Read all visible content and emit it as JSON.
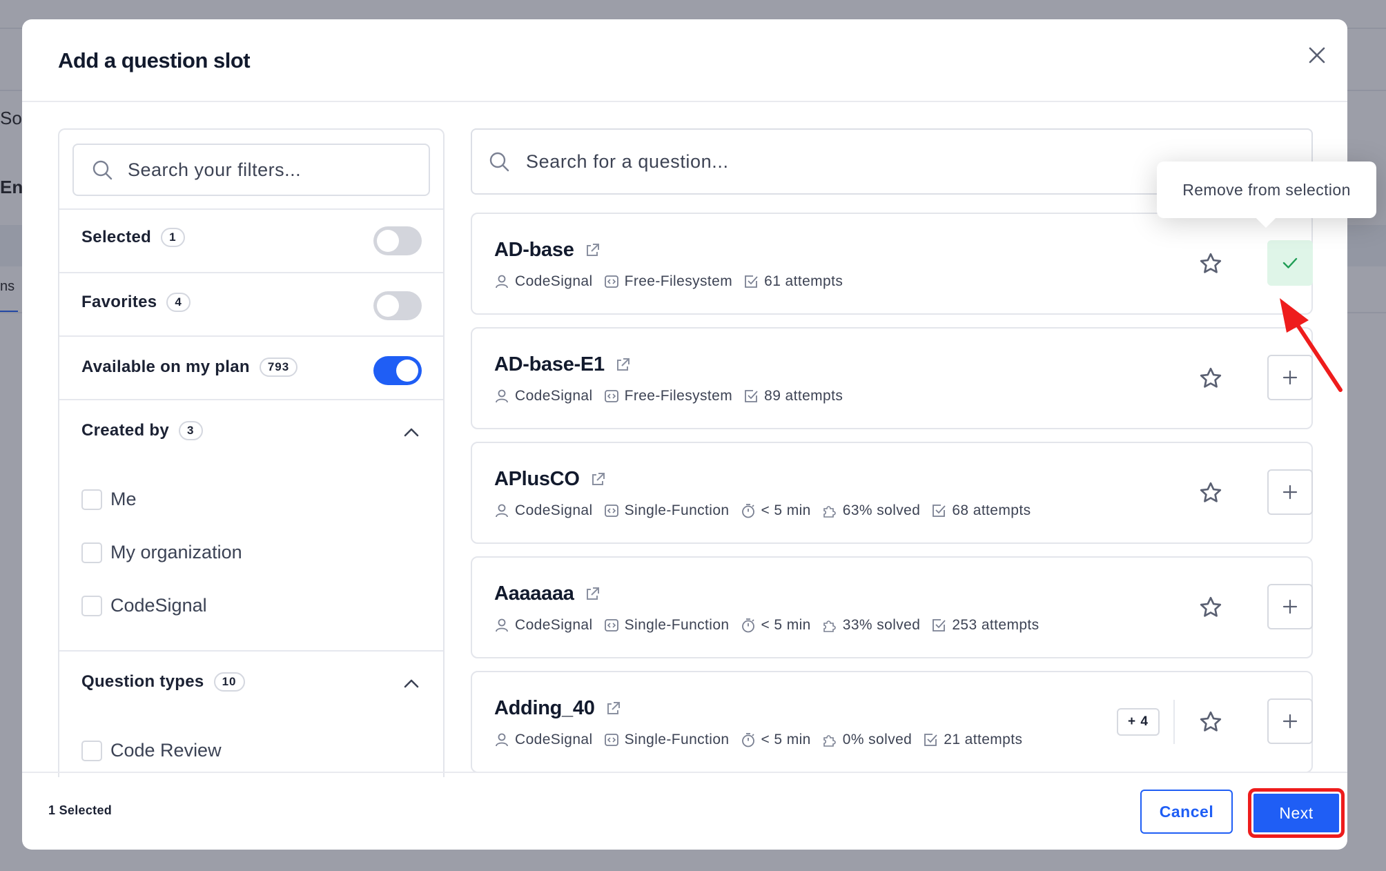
{
  "background": {
    "fragments": [
      "So",
      "En",
      "ns"
    ]
  },
  "modal": {
    "title": "Add a question slot"
  },
  "filters": {
    "search_placeholder": "Search your filters...",
    "toggles": [
      {
        "label": "Selected",
        "count": "1",
        "on": false
      },
      {
        "label": "Favorites",
        "count": "4",
        "on": false
      },
      {
        "label": "Available on my plan",
        "count": "793",
        "on": true
      }
    ],
    "created_by": {
      "label": "Created by",
      "count": "3",
      "options": [
        "Me",
        "My organization",
        "CodeSignal"
      ]
    },
    "question_types": {
      "label": "Question types",
      "count": "10",
      "options": [
        "Code Review"
      ]
    }
  },
  "questions": {
    "search_placeholder": "Search for a question...",
    "tooltip": "Remove from selection",
    "items": [
      {
        "title": "AD-base",
        "author": "CodeSignal",
        "type": "Free-Filesystem",
        "attempts": "61 attempts",
        "selected": true
      },
      {
        "title": "AD-base-E1",
        "author": "CodeSignal",
        "type": "Free-Filesystem",
        "attempts": "89 attempts",
        "selected": false
      },
      {
        "title": "APlusCO",
        "author": "CodeSignal",
        "type": "Single-Function",
        "time": "< 5 min",
        "solved": "63% solved",
        "attempts": "68 attempts",
        "selected": false
      },
      {
        "title": "Aaaaaaa",
        "author": "CodeSignal",
        "type": "Single-Function",
        "time": "< 5 min",
        "solved": "33% solved",
        "attempts": "253 attempts",
        "selected": false
      },
      {
        "title": "Adding_40",
        "author": "CodeSignal",
        "type": "Single-Function",
        "time": "< 5 min",
        "solved": "0% solved",
        "attempts": "21 attempts",
        "more": "+ 4",
        "selected": false
      }
    ]
  },
  "footer": {
    "selected_count": "1 Selected",
    "cancel_label": "Cancel",
    "next_label": "Next"
  },
  "colors": {
    "accent": "#1f5ef5",
    "highlight": "#ee1c1c",
    "selected_bg": "#dff5e8",
    "check": "#1f9d55"
  }
}
